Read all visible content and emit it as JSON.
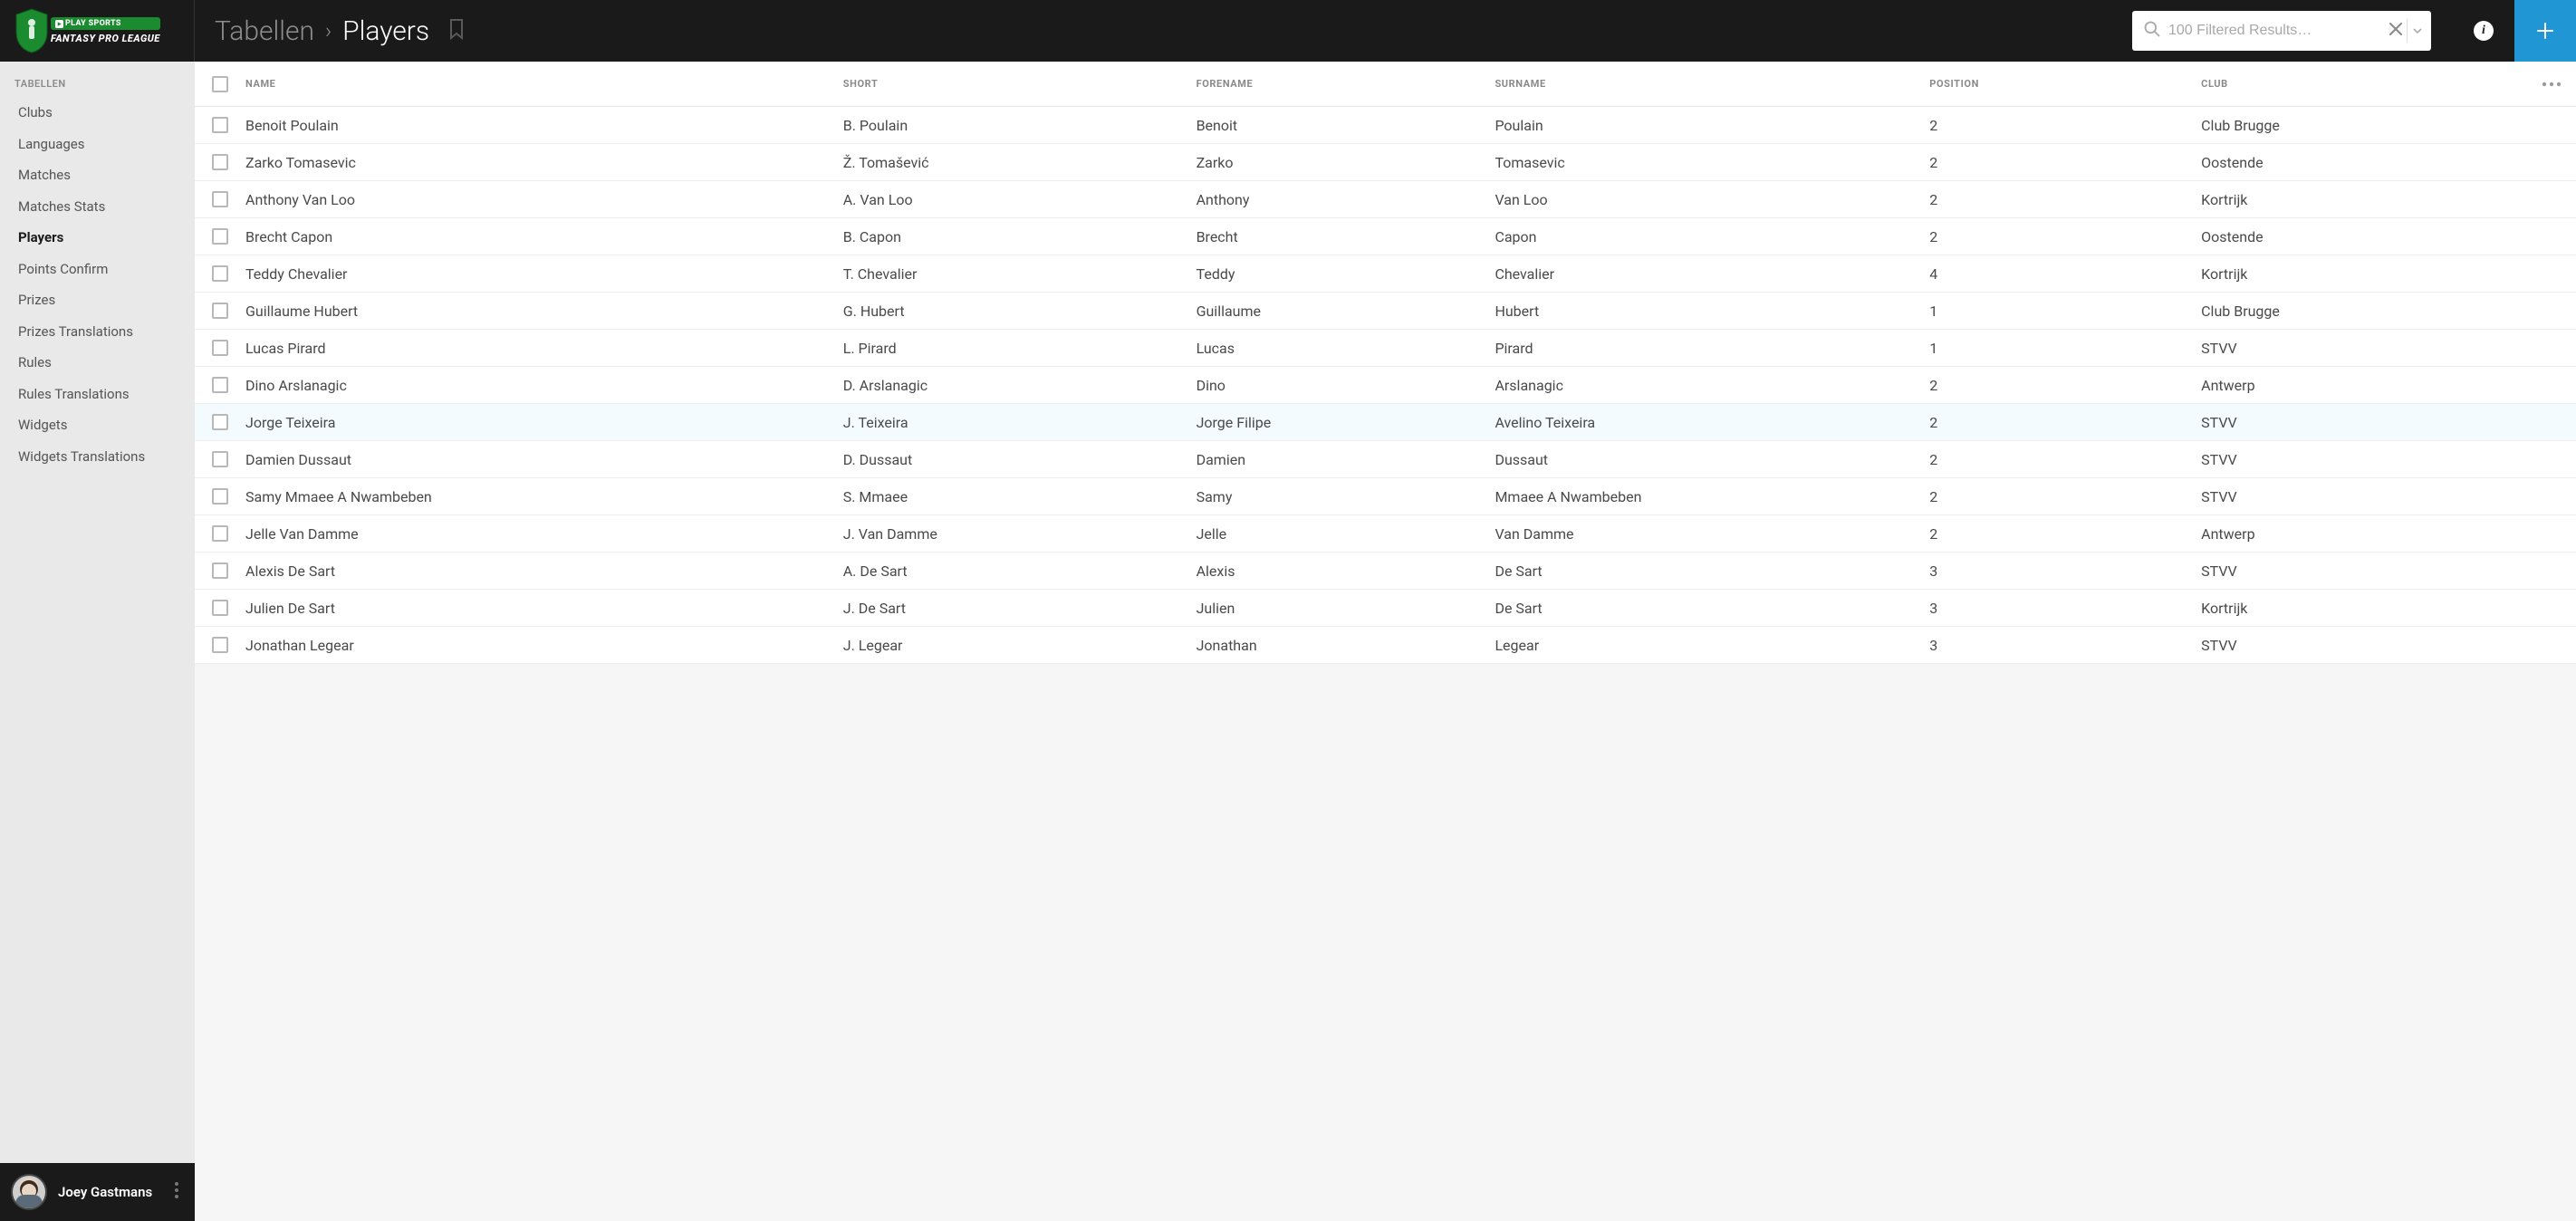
{
  "brand": {
    "play_sports": "PLAY SPORTS",
    "fantasy": "FANTASY PRO LEAGUE"
  },
  "breadcrumb": {
    "parent": "Tabellen",
    "current": "Players"
  },
  "search": {
    "placeholder": "100 Filtered Results…"
  },
  "sidebar": {
    "section_label": "TABELLEN",
    "items": [
      {
        "label": "Clubs",
        "active": false
      },
      {
        "label": "Languages",
        "active": false
      },
      {
        "label": "Matches",
        "active": false
      },
      {
        "label": "Matches Stats",
        "active": false
      },
      {
        "label": "Players",
        "active": true
      },
      {
        "label": "Points Confirm",
        "active": false
      },
      {
        "label": "Prizes",
        "active": false
      },
      {
        "label": "Prizes Translations",
        "active": false
      },
      {
        "label": "Rules",
        "active": false
      },
      {
        "label": "Rules Translations",
        "active": false
      },
      {
        "label": "Widgets",
        "active": false
      },
      {
        "label": "Widgets Translations",
        "active": false
      }
    ]
  },
  "user": {
    "name": "Joey Gastmans"
  },
  "table": {
    "columns": [
      "NAME",
      "SHORT",
      "FORENAME",
      "SURNAME",
      "POSITION",
      "CLUB"
    ],
    "rows": [
      {
        "name": "Benoit Poulain",
        "short": "B. Poulain",
        "forename": "Benoit",
        "surname": "Poulain",
        "position": "2",
        "club": "Club Brugge",
        "hover": false
      },
      {
        "name": "Zarko Tomasevic",
        "short": "Ž. Tomašević",
        "forename": "Zarko",
        "surname": "Tomasevic",
        "position": "2",
        "club": "Oostende",
        "hover": false
      },
      {
        "name": "Anthony Van Loo",
        "short": "A. Van Loo",
        "forename": "Anthony",
        "surname": "Van Loo",
        "position": "2",
        "club": "Kortrijk",
        "hover": false
      },
      {
        "name": "Brecht Capon",
        "short": "B. Capon",
        "forename": "Brecht",
        "surname": "Capon",
        "position": "2",
        "club": "Oostende",
        "hover": false
      },
      {
        "name": "Teddy Chevalier",
        "short": "T. Chevalier",
        "forename": "Teddy",
        "surname": "Chevalier",
        "position": "4",
        "club": "Kortrijk",
        "hover": false
      },
      {
        "name": "Guillaume Hubert",
        "short": "G. Hubert",
        "forename": "Guillaume",
        "surname": "Hubert",
        "position": "1",
        "club": "Club Brugge",
        "hover": false
      },
      {
        "name": "Lucas Pirard",
        "short": "L. Pirard",
        "forename": "Lucas",
        "surname": "Pirard",
        "position": "1",
        "club": "STVV",
        "hover": false
      },
      {
        "name": "Dino Arslanagic",
        "short": "D. Arslanagic",
        "forename": "Dino",
        "surname": "Arslanagic",
        "position": "2",
        "club": "Antwerp",
        "hover": false
      },
      {
        "name": "Jorge Teixeira",
        "short": "J. Teixeira",
        "forename": "Jorge Filipe",
        "surname": "Avelino Teixeira",
        "position": "2",
        "club": "STVV",
        "hover": true
      },
      {
        "name": "Damien Dussaut",
        "short": "D. Dussaut",
        "forename": "Damien",
        "surname": "Dussaut",
        "position": "2",
        "club": "STVV",
        "hover": false
      },
      {
        "name": "Samy Mmaee A Nwambeben",
        "short": "S. Mmaee",
        "forename": "Samy",
        "surname": "Mmaee A Nwambeben",
        "position": "2",
        "club": "STVV",
        "hover": false
      },
      {
        "name": "Jelle Van Damme",
        "short": "J. Van Damme",
        "forename": "Jelle",
        "surname": "Van Damme",
        "position": "2",
        "club": "Antwerp",
        "hover": false
      },
      {
        "name": "Alexis De Sart",
        "short": "A. De Sart",
        "forename": "Alexis",
        "surname": "De Sart",
        "position": "3",
        "club": "STVV",
        "hover": false
      },
      {
        "name": "Julien De Sart",
        "short": "J. De Sart",
        "forename": "Julien",
        "surname": "De Sart",
        "position": "3",
        "club": "Kortrijk",
        "hover": false
      },
      {
        "name": "Jonathan Legear",
        "short": "J. Legear",
        "forename": "Jonathan",
        "surname": "Legear",
        "position": "3",
        "club": "STVV",
        "hover": false
      }
    ]
  }
}
